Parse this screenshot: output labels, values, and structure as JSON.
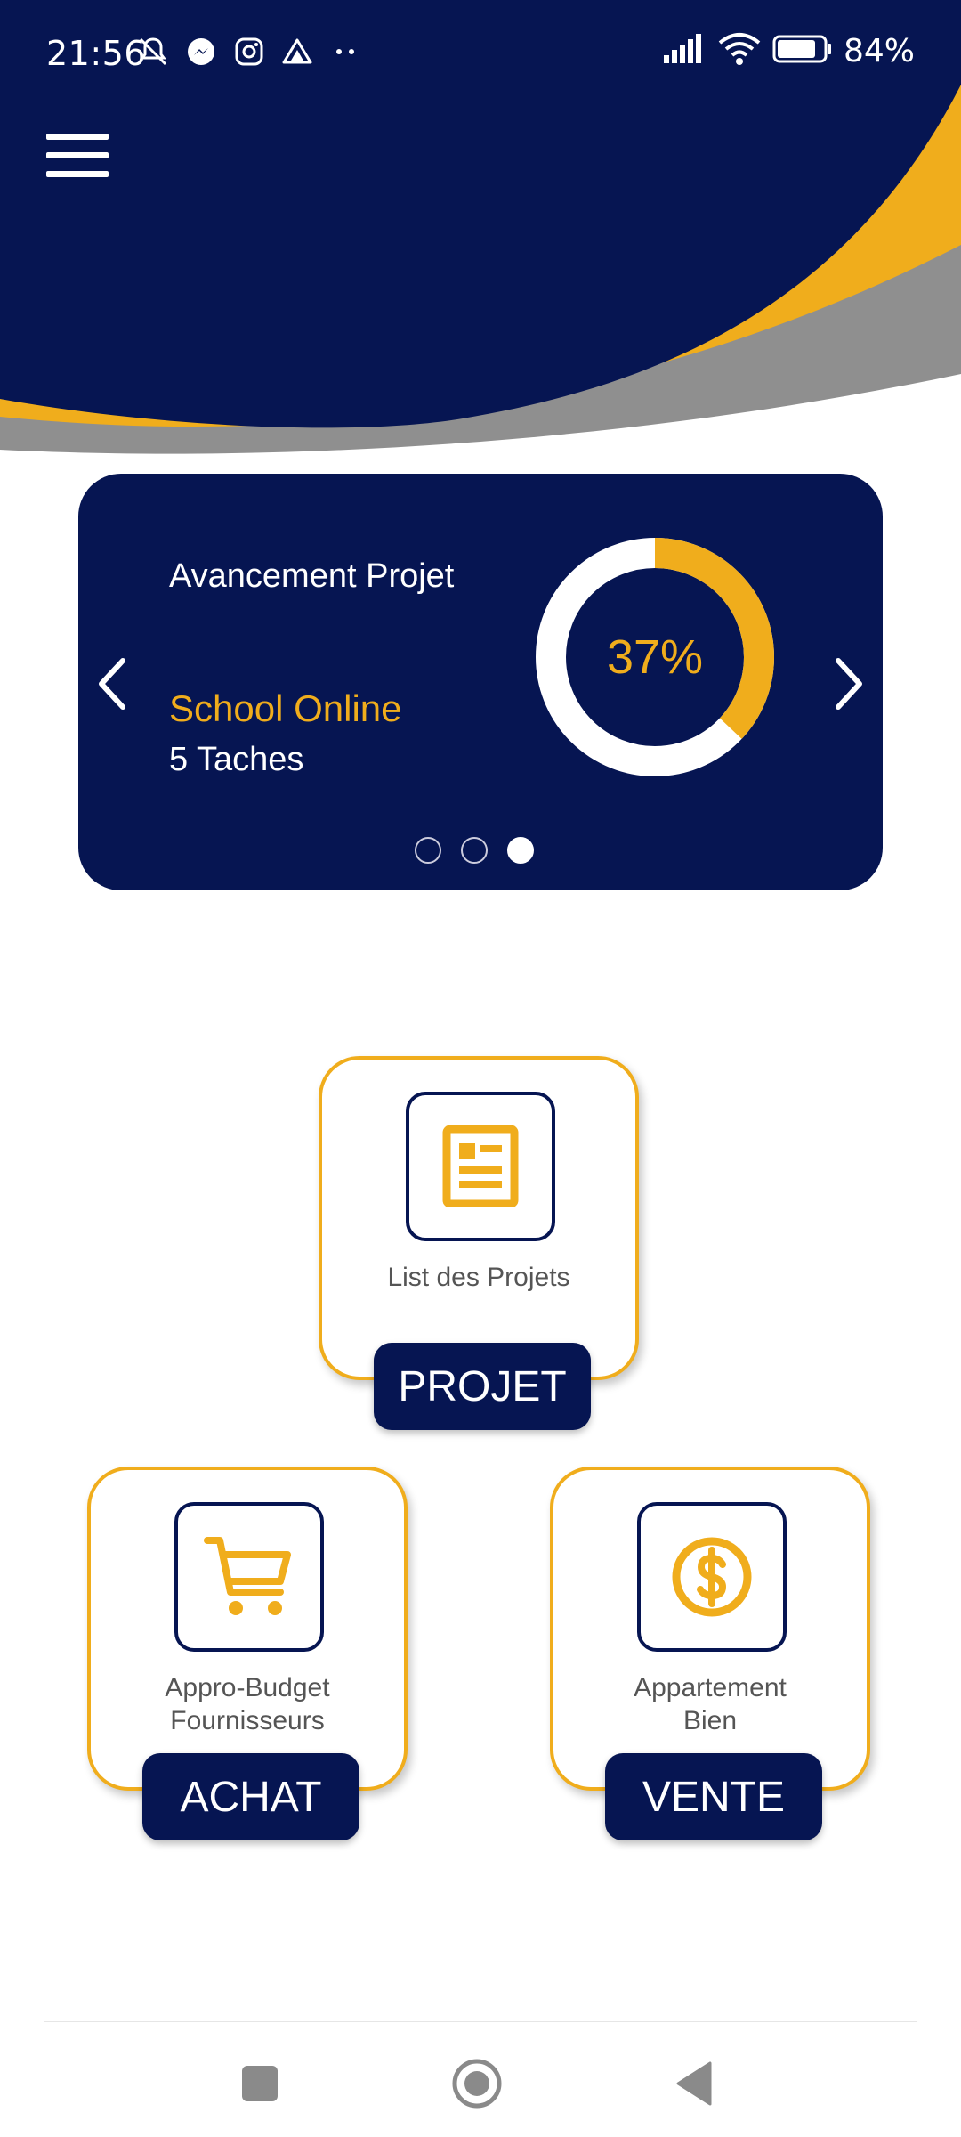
{
  "status_bar": {
    "time": "21:56",
    "left_icons": [
      "mute-icon",
      "messenger-icon",
      "instagram-icon",
      "drive-icon",
      "more-dots-icon"
    ],
    "right_icons": [
      "signal-icon",
      "wifi-icon",
      "battery-icon"
    ],
    "battery_percent": "84%",
    "battery_level": 0.84
  },
  "header": {
    "menu_icon": "hamburger-menu-icon",
    "colors": {
      "navy": "#061552",
      "gold": "#f0ad1c",
      "gray": "#8f8f8f"
    }
  },
  "progress_card": {
    "title": "Avancement Projet",
    "project_name": "School Online",
    "tasks": "5 Taches",
    "percent_label": "37%",
    "percent_value": 0.37,
    "page_count": 3,
    "active_page": 3,
    "prev_icon": "chevron-left-icon",
    "next_icon": "chevron-right-icon"
  },
  "tiles": {
    "projet": {
      "icon": "document-list-icon",
      "label_line1": "List des Projets",
      "label_line2": "",
      "badge": "PROJET"
    },
    "achat": {
      "icon": "shopping-cart-icon",
      "label_line1": "Appro-Budget",
      "label_line2": "Fournisseurs",
      "badge": "ACHAT"
    },
    "vente": {
      "icon": "dollar-coin-icon",
      "label_line1": "Appartement",
      "label_line2": "Bien",
      "badge": "VENTE"
    }
  },
  "system_nav": {
    "recent": "square-recents-icon",
    "home": "circle-home-icon",
    "back": "triangle-back-icon"
  }
}
